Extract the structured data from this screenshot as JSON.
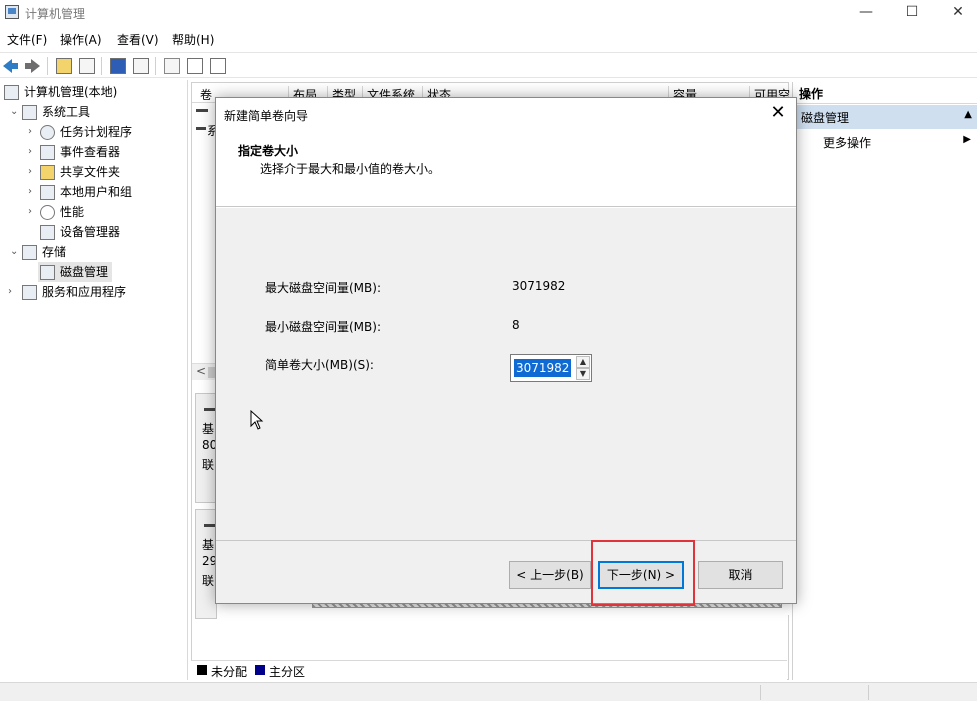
{
  "window": {
    "title": "计算机管理",
    "controls": {
      "minimize": "—",
      "maximize": "☐",
      "close": "✕"
    }
  },
  "menubar": [
    "文件(F)",
    "操作(A)",
    "查看(V)",
    "帮助(H)"
  ],
  "tree": {
    "root": "计算机管理(本地)",
    "system_tools": "系统工具",
    "task_scheduler": "任务计划程序",
    "event_viewer": "事件查看器",
    "shared_folders": "共享文件夹",
    "local_users": "本地用户和组",
    "performance": "性能",
    "device_manager": "设备管理器",
    "storage": "存储",
    "disk_management": "磁盘管理",
    "services_apps": "服务和应用程序"
  },
  "columns": [
    "卷",
    "布局",
    "类型",
    "文件系统",
    "状态",
    "容量",
    "可用空"
  ],
  "disk_cards": {
    "disk0": [
      "基",
      "80",
      "联"
    ],
    "disk1": [
      "基",
      "29",
      "联"
    ]
  },
  "list_row_label": "系",
  "legend": {
    "unallocated": "未分配",
    "primary": "主分区",
    "unallocated_color": "#000000",
    "primary_color": "#00008b"
  },
  "actions": {
    "header": "操作",
    "section": "磁盘管理",
    "more": "更多操作"
  },
  "dialog": {
    "title": "新建简单卷向导",
    "heading": "指定卷大小",
    "subheading": "选择介于最大和最小值的卷大小。",
    "max_label": "最大磁盘空间量(MB):",
    "max_value": "3071982",
    "min_label": "最小磁盘空间量(MB):",
    "min_value": "8",
    "size_label": "简单卷大小(MB)(S):",
    "size_value": "3071982",
    "back_button": "< 上一步(B)",
    "next_button": "下一步(N) >",
    "cancel_button": "取消"
  },
  "colors": {
    "highlight_box": "#e0343a",
    "selection": "#0f6ad3",
    "action_section": "#cfdff0"
  }
}
